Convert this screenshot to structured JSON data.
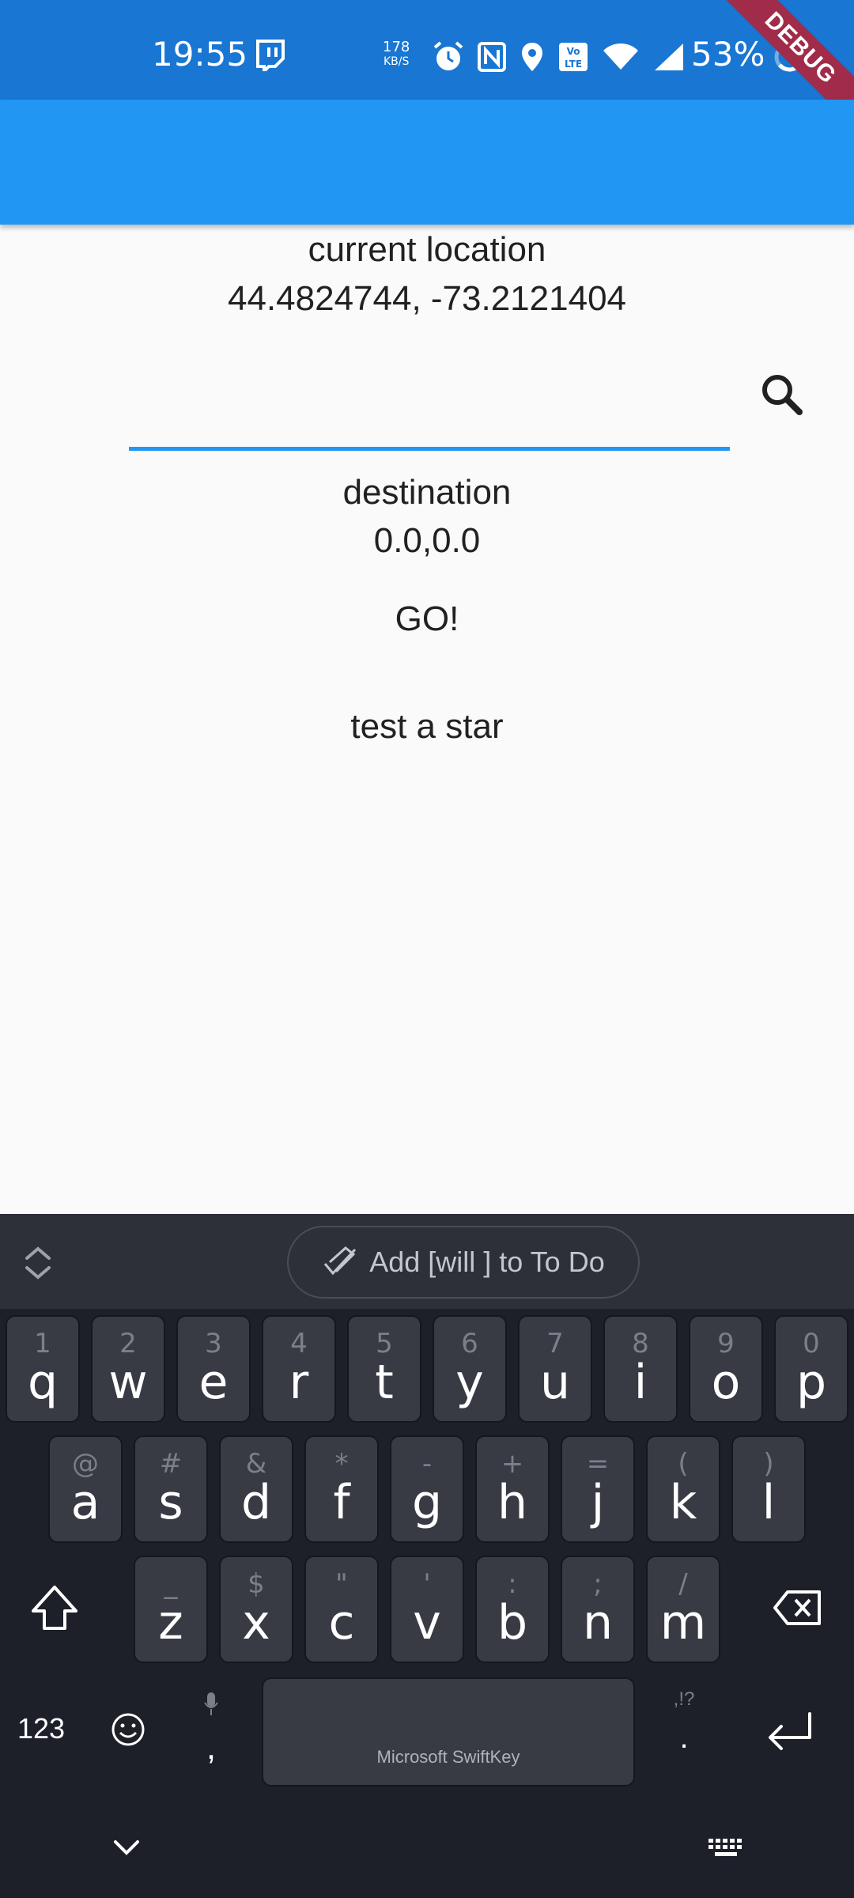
{
  "status_bar": {
    "time": "19:55",
    "speed_value": "178",
    "speed_unit": "KB/S",
    "battery": "53%",
    "debug_banner": "DEBUG",
    "icons": [
      "twitch-icon",
      "alarm-icon",
      "nfc-icon",
      "location-icon",
      "volte-icon",
      "wifi-icon",
      "signal-icon",
      "battery-ring-icon"
    ]
  },
  "app": {
    "current_label": "current location",
    "current_coords": "44.4824744, -73.2121404",
    "search_value": "",
    "destination_label": "destination",
    "destination_coords": "0.0,0.0",
    "go_label": "GO!",
    "astar_label": "test a star"
  },
  "keyboard": {
    "suggestion": "Add [will ] to To Do",
    "row1": [
      {
        "k": "q",
        "h": "1"
      },
      {
        "k": "w",
        "h": "2"
      },
      {
        "k": "e",
        "h": "3"
      },
      {
        "k": "r",
        "h": "4"
      },
      {
        "k": "t",
        "h": "5"
      },
      {
        "k": "y",
        "h": "6"
      },
      {
        "k": "u",
        "h": "7"
      },
      {
        "k": "i",
        "h": "8"
      },
      {
        "k": "o",
        "h": "9"
      },
      {
        "k": "p",
        "h": "0"
      }
    ],
    "row2": [
      {
        "k": "a",
        "h": "@"
      },
      {
        "k": "s",
        "h": "#"
      },
      {
        "k": "d",
        "h": "&"
      },
      {
        "k": "f",
        "h": "*"
      },
      {
        "k": "g",
        "h": "-"
      },
      {
        "k": "h",
        "h": "+"
      },
      {
        "k": "j",
        "h": "="
      },
      {
        "k": "k",
        "h": "("
      },
      {
        "k": "l",
        "h": ")"
      }
    ],
    "row3": [
      {
        "k": "z",
        "h": "_"
      },
      {
        "k": "x",
        "h": "$"
      },
      {
        "k": "c",
        "h": "\""
      },
      {
        "k": "v",
        "h": "'"
      },
      {
        "k": "b",
        "h": ":"
      },
      {
        "k": "n",
        "h": ";"
      },
      {
        "k": "m",
        "h": "/"
      }
    ],
    "numbers_label": "123",
    "comma": ",",
    "space_label": "Microsoft SwiftKey",
    "period_hint": ",!?",
    "period": "."
  }
}
